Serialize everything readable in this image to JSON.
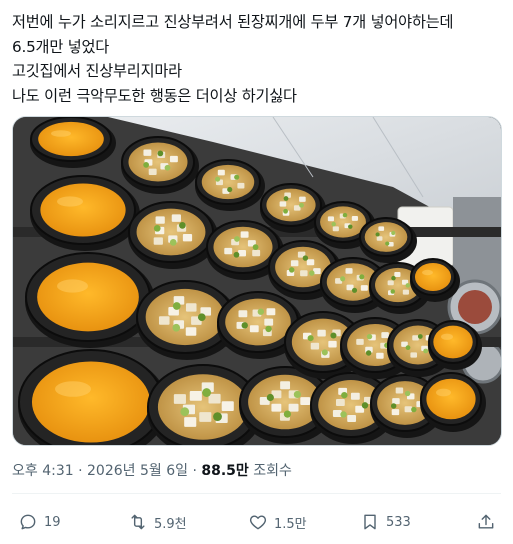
{
  "tweet": {
    "lines": [
      "저번에 누가 소리지르고 진상부려서 된장찌개에 두부 7개 넣어야하는데",
      "6.5개만 넣었다",
      "고깃집에서 진상부리지마라",
      "나도 이런 극악무도한 행동은 더이상 하기싫다"
    ]
  },
  "meta": {
    "time": "오후 4:31",
    "separator": "·",
    "date": "2026년 5월 6일",
    "views_count": "88.5만",
    "views_label": "조회수"
  },
  "actions": {
    "reply_count": "19",
    "retweet_count": "5.9천",
    "like_count": "1.5만",
    "bookmark_count": "533"
  },
  "icons": [
    "reply-icon",
    "retweet-icon",
    "like-icon",
    "bookmark-icon",
    "share-icon"
  ],
  "colors": {
    "text": "#0f1419",
    "secondary": "#536471",
    "border": "#cfd9de",
    "pot": "#1b1b1b",
    "egg": "#f2a51b",
    "stew": "#d9b46a"
  }
}
